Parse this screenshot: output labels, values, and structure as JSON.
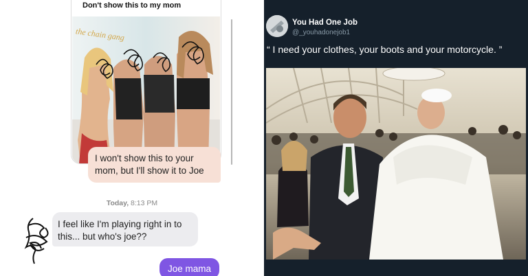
{
  "chat": {
    "top_message_title": "Don't show this to my mom",
    "image_banner_text": "the chain gang",
    "outgoing_reply": "I won't show this to your mom, but I'll show it to Joe",
    "timestamp_day": "Today,",
    "timestamp_time": "8:13 PM",
    "incoming_message": "I feel like I'm playing right in to this... but who's joe??",
    "final_reply": "Joe mama",
    "colors": {
      "outgoing_peach": "#f7e0d6",
      "final_purple": "#7f56e3",
      "incoming_grey": "#ececef"
    }
  },
  "tweet": {
    "display_name": "You Had One Job",
    "handle": "@_youhadonejob1",
    "text": "“ I need your clothes, your boots and your motorcycle. ”",
    "background": "#15202b"
  }
}
